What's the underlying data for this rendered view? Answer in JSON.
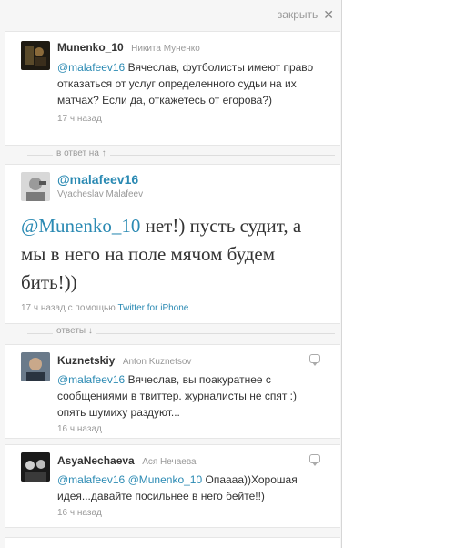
{
  "close": {
    "label": "закрыть",
    "icon": "close-icon"
  },
  "original_tweet": {
    "username": "Munenko_10",
    "realname": "Никита Муненко",
    "mention": "@malafeev16",
    "text": " Вячеслав, футболисты имеют право отказаться от услуг определенного судьи на их матчах? Если да, откажетесь от егорова?)",
    "time": "17 ч назад"
  },
  "in_reply_to": {
    "label": "в ответ на",
    "arrow": "↑"
  },
  "main_tweet": {
    "username": "@malafeev16",
    "realname": "Vyacheslav Malafeev",
    "mention": "@Munenko_10",
    "text": " нет!) пусть судит, а мы в него на поле мячом будем бить!))",
    "time": "17 ч назад",
    "via_prefix": "с помощью",
    "via_link": "Twitter for iPhone"
  },
  "replies_header": {
    "label": "ответы",
    "arrow": "↓"
  },
  "replies": [
    {
      "username": "Kuznetskiy",
      "realname": "Anton Kuznetsov",
      "mention": "@malafeev16",
      "mention2": "",
      "text": " Вячеслав, вы поакуратнее с сообщениями в твиттер. журналисты не спят :) опять шумиху раздуют...",
      "time": "16 ч назад"
    },
    {
      "username": "AsyaNechaeva",
      "realname": "Ася Нечаева",
      "mention": "@malafeev16",
      "mention2": "@Munenko_10",
      "text": " Опаааа))Хорошая идея...давайте посильнее в него бейте!!)",
      "time": "16 ч назад"
    }
  ],
  "colors": {
    "link": "#2b8ab3",
    "muted": "#999999",
    "text": "#333333",
    "panel_bg": "#f6f6f6"
  }
}
